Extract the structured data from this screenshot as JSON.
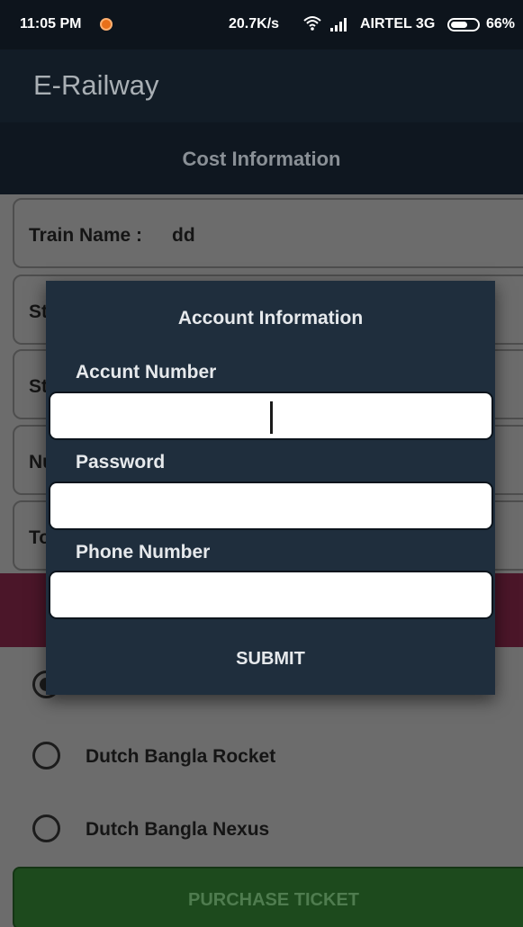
{
  "status_bar": {
    "time": "11:05 PM",
    "speed": "20.7K/s",
    "carrier": "AIRTEL 3G",
    "battery": "66%",
    "battery_level": 0.66,
    "notification_color": "#e8701a"
  },
  "app_bar": {
    "title": "E-Railway"
  },
  "section_header": "Cost Information",
  "fields": [
    {
      "label": "Train Name :",
      "value": "dd"
    },
    {
      "label": "St",
      "value": ""
    },
    {
      "label": "St",
      "value": ""
    },
    {
      "label": "Nu",
      "value": ""
    },
    {
      "label": "To",
      "value": ""
    }
  ],
  "payment_options": [
    {
      "label": "",
      "checked": true
    },
    {
      "label": "Dutch Bangla Rocket",
      "checked": false
    },
    {
      "label": "Dutch Bangla Nexus",
      "checked": false
    }
  ],
  "purchase_button": "PURCHASE TICKET",
  "dialog": {
    "title": "Account Information",
    "account_label": "Accunt Number",
    "account_value": "",
    "password_label": "Password",
    "password_value": "",
    "phone_label": "Phone Number",
    "phone_value": "",
    "submit_label": "SUBMIT"
  },
  "colors": {
    "app_bar": "#121c26",
    "dialog": "#1f2e3d",
    "accent_band": "#4b1629",
    "purchase_button": "#1d4a1d"
  }
}
